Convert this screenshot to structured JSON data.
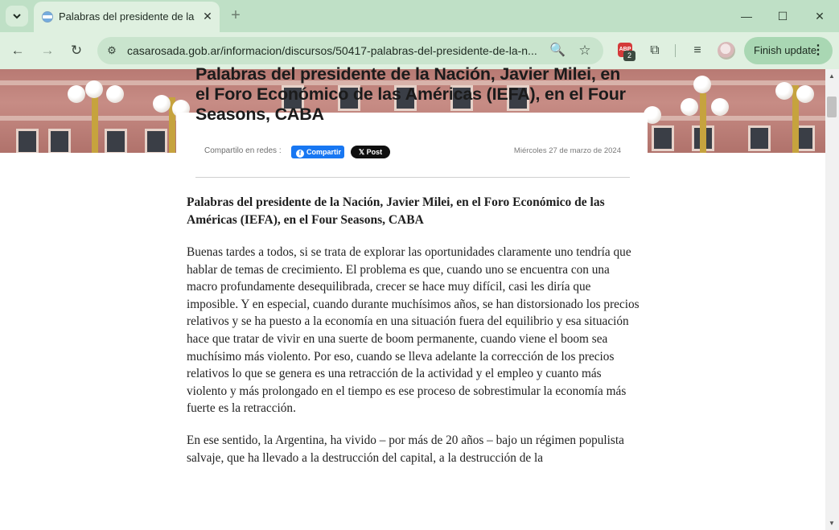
{
  "browser": {
    "tab_title": "Palabras del presidente de la Nación, Javier Milei",
    "tab_close_icon": "close-icon",
    "new_tab_label": "+",
    "url": "casarosada.gob.ar/informacion/discursos/50417-palabras-del-presidente-de-la-n...",
    "finish_update_label": "Finish update",
    "extension_badge": "2",
    "extension_label": "ABP"
  },
  "article": {
    "headline": "Palabras del presidente de la Nación, Javier Milei, en el Foro Económico de las Américas (IEFA), en el Four Seasons, CABA",
    "share_label": "Compartilo en redes :",
    "facebook_label": "Compartir",
    "x_label": "Post",
    "date": "Miércoles 27 de marzo de 2024",
    "lead": "Palabras del presidente de la Nación, Javier Milei, en el Foro Económico de las Américas (IEFA), en el Four Seasons, CABA",
    "paragraph_1": "Buenas tardes a todos, si se trata de explorar las oportunidades claramente uno tendría que hablar de temas de crecimiento. El problema es que, cuando uno se encuentra con una macro profundamente desequilibrada, crecer se hace muy difícil, casi les diría que imposible. Y en especial, cuando durante muchísimos años, se han distorsionado los precios relativos y se ha puesto a la economía en una situación fuera del equilibrio y esa situación hace que tratar de vivir en una suerte de boom permanente, cuando viene el boom sea muchísimo más violento. Por eso, cuando se lleva adelante la corrección de los precios relativos lo que se genera es una retracción de la actividad y el empleo y cuanto más violento y más prolongado en el tiempo es ese proceso de sobrestimular la economía más fuerte es la retracción.",
    "paragraph_2": "En ese sentido, la Argentina, ha vivido – por más de 20 años – bajo un régimen populista salvaje, que ha llevado a la destrucción del capital, a la destrucción de la"
  }
}
